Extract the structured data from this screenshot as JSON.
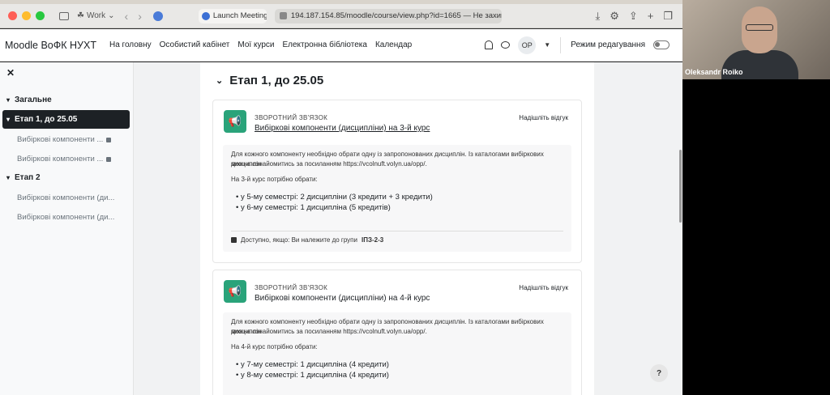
{
  "browser": {
    "profile": "Work",
    "tab_title": "Launch Meeting...",
    "url": "194.187.154.85/moodle/course/view.php?id=1665 — Не захищений"
  },
  "header": {
    "brand": "Moodle ВоФК НУХТ",
    "nav": [
      "На головну",
      "Особистий кабінет",
      "Мої курси",
      "Електронна бібліотека",
      "Календар"
    ],
    "avatar_initials": "ОР",
    "edit_mode_label": "Режим редагування",
    "edit_mode_on": false
  },
  "sidebar": {
    "sections": [
      {
        "label": "Загальне"
      },
      {
        "label": "Етап 1, до 25.05"
      },
      {
        "label": "Етап 2"
      }
    ],
    "activities_stage1": [
      "Вибіркові компоненти ...",
      "Вибіркові компоненти ..."
    ],
    "activities_stage2": [
      "Вибіркові компоненти (ди...",
      "Вибіркові компоненти (ди..."
    ]
  },
  "main": {
    "section_title": "Етап 1, до 25.05",
    "cards": [
      {
        "type": "ЗВОРОТНИЙ ЗВ'ЯЗОК",
        "name": "Вибіркові компоненти (дисципліни) на 3-й курс",
        "action": "Надішліть відгук",
        "desc_line1": "Для кожного компоненту необхідно обрати одну із запропонованих дисциплін. Із каталогами вибіркових дисциплін",
        "desc_line2": "можна ознайомитись за посиланням https://vcolnuft.volyn.ua/opp/.",
        "intro": "На 3-й курс потрібно обрати:",
        "bullets": [
          "у 5-му семестрі: 2 дисципліни (3 кредити + 3 кредити)",
          "у 6-му семестрі: 1 дисципліна (5 кредитів)"
        ],
        "restriction_prefix": "Доступно, якщо: Ви належите до групи",
        "restriction_group": "ІПЗ-2-3"
      },
      {
        "type": "ЗВОРОТНИЙ ЗВ'ЯЗОК",
        "name": "Вибіркові компоненти (дисципліни) на 4-й курс",
        "action": "Надішліть відгук",
        "desc_line1": "Для кожного компоненту необхідно обрати одну із запропонованих дисциплін. Із каталогами вибіркових дисциплін",
        "desc_line2": "можна ознайомитись за посиланням https://vcolnuft.volyn.ua/opp/.",
        "intro": "На 4-й курс потрібно обрати:",
        "bullets": [
          "у 7-му семестрі: 1 дисципліна (4 кредити)",
          "у 8-му семестрі: 1 дисципліна (4 кредити)"
        ]
      }
    ],
    "help_label": "?"
  },
  "video": {
    "participant_name": "Oleksandr Roiko"
  },
  "colors": {
    "feedback_icon_bg": "#2aa37a",
    "active_section_bg": "#1d2125"
  }
}
